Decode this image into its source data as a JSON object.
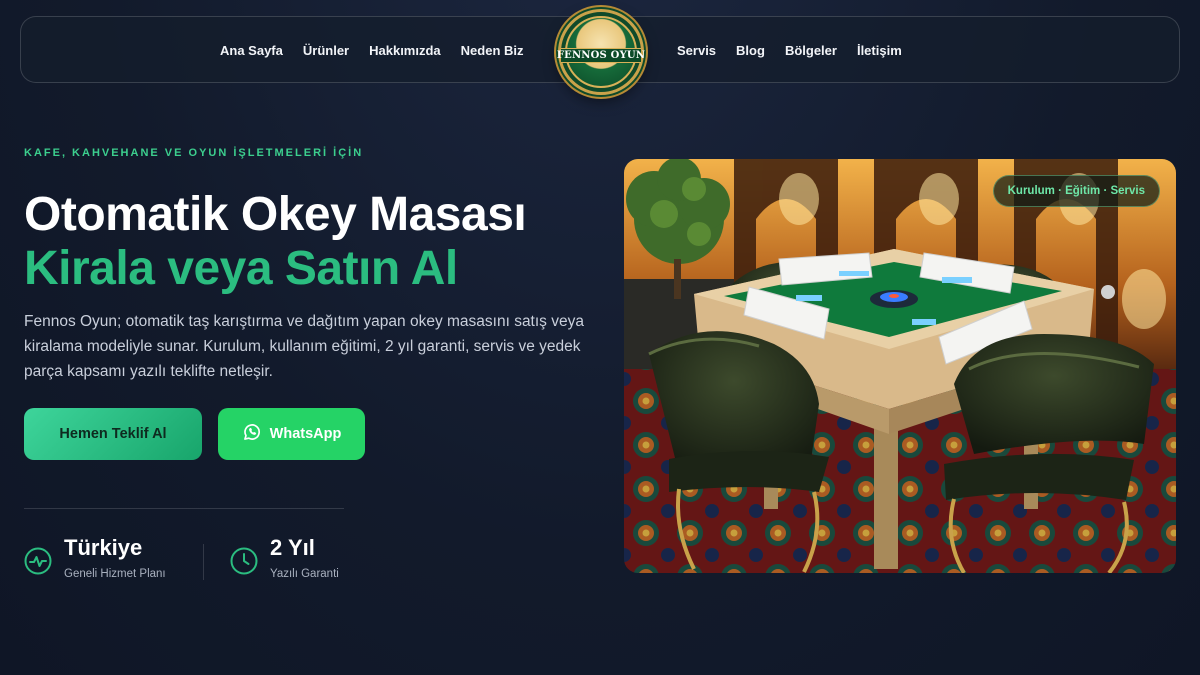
{
  "nav": {
    "left_links": [
      "Ana Sayfa",
      "Ürünler",
      "Hakkımızda",
      "Neden Biz"
    ],
    "right_links": [
      "Servis",
      "Blog",
      "Bölgeler",
      "İletişim"
    ],
    "logo_text": "FENNOS OYUN"
  },
  "hero": {
    "eyebrow": "KAFE, KAHVEHANE VE OYUN İŞLETMELERİ İÇİN",
    "title_line1": "Otomatik Okey Masası",
    "title_line2": "Kirala veya Satın Al",
    "description": "Fennos Oyun; otomatik taş karıştırma ve dağıtım yapan okey masasını satış veya kiralama modeliyle sunar. Kurulum, kullanım eğitimi, 2 yıl garanti, servis ve yedek parça kapsamı yazılı teklifte netleşir.",
    "cta_primary": "Hemen Teklif Al",
    "cta_whatsapp": "WhatsApp",
    "stats": [
      {
        "value": "Türkiye",
        "label": "Geneli Hizmet Planı",
        "icon": "activity-icon"
      },
      {
        "value": "2 Yıl",
        "label": "Yazılı Garanti",
        "icon": "clock-icon"
      }
    ],
    "image_badge": "Kurulum · Eğitim · Servis"
  },
  "colors": {
    "background": "#121a2b",
    "accent_green": "#2bbd80",
    "whatsapp_green": "#25d366",
    "logo_green": "#0c4a28",
    "logo_gold": "#c9a24a"
  }
}
